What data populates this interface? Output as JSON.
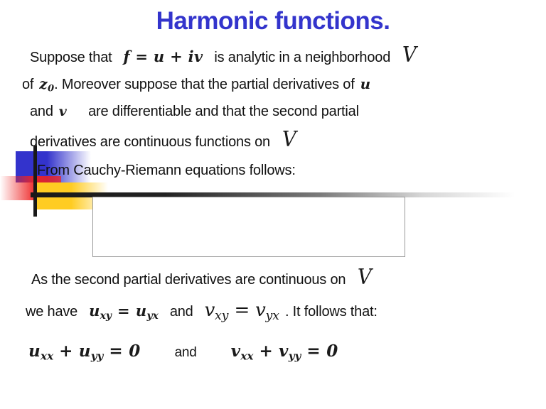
{
  "slide": {
    "title": "Harmonic functions.",
    "title_color": "#3333CC",
    "background_color": "#FFFFFF",
    "text_color": "#111111"
  },
  "body": {
    "line1": {
      "part1": "Suppose that",
      "math1": "f = u + iv",
      "part2": "is analytic in a neighborhood",
      "math2": "V"
    },
    "line2": {
      "part1": "of",
      "math1": "z",
      "math1_sub": "0",
      "part2": ". Moreover suppose that the partial derivatives of",
      "math2": "u"
    },
    "line3": {
      "part1": "and",
      "math1": "v",
      "part2": "are differentiable and that the second partial"
    },
    "line4": {
      "part1": "derivatives are continuous functions on",
      "math1": "V"
    },
    "line5": {
      "part1": "From Cauchy-Riemann equations follows:"
    },
    "line6": {
      "part1": "As the second partial derivatives are continuous on",
      "math1": "V"
    },
    "line7": {
      "part1": "we have",
      "math1": "u",
      "math1_sub_a": "xy",
      "math1_eq": "=",
      "math1_b": "u",
      "math1_sub_b": "yx",
      "part2": "and",
      "math2": "v",
      "math2_sub_a": "xy",
      "math2_eq": "=",
      "math2_b": "v",
      "math2_sub_b": "yx",
      "part3": ". It follows that:"
    },
    "line8": {
      "math1_a": "u",
      "math1_sub_a": "xx",
      "math1_plus": "+",
      "math1_b": "u",
      "math1_sub_b": "yy",
      "math1_eq": "= 0",
      "conj": "and",
      "math2_a": "v",
      "math2_sub_a": "xx",
      "math2_plus": "+",
      "math2_b": "v",
      "math2_sub_b": "yy",
      "math2_eq": "= 0"
    }
  },
  "content_box": {
    "value": ""
  },
  "decoration": {
    "blue": "#3333CC",
    "red": "#EE2222",
    "yellow": "#FFCC22",
    "line": "#191919"
  }
}
